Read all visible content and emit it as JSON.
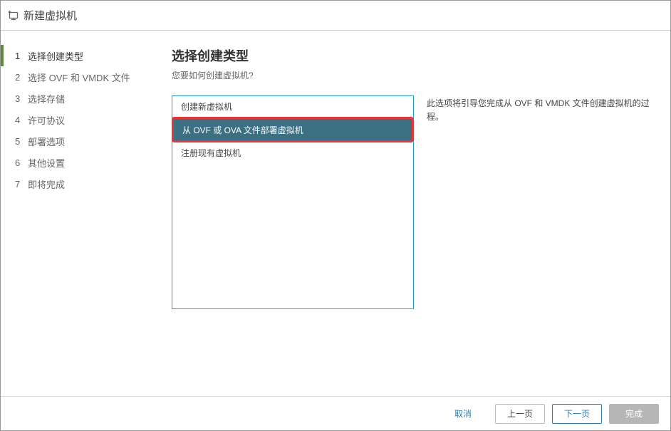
{
  "dialog": {
    "title": "新建虚拟机"
  },
  "sidebar": {
    "steps": [
      {
        "num": "1",
        "label": "选择创建类型",
        "current": true
      },
      {
        "num": "2",
        "label": "选择 OVF 和 VMDK 文件",
        "current": false
      },
      {
        "num": "3",
        "label": "选择存储",
        "current": false
      },
      {
        "num": "4",
        "label": "许可协议",
        "current": false
      },
      {
        "num": "5",
        "label": "部署选项",
        "current": false
      },
      {
        "num": "6",
        "label": "其他设置",
        "current": false
      },
      {
        "num": "7",
        "label": "即将完成",
        "current": false
      }
    ]
  },
  "main": {
    "title": "选择创建类型",
    "subtitle": "您要如何创建虚拟机?",
    "options": [
      {
        "label": "创建新虚拟机",
        "selected": false
      },
      {
        "label": "从 OVF 或 OVA 文件部署虚拟机",
        "selected": true
      },
      {
        "label": "注册现有虚拟机",
        "selected": false
      }
    ],
    "description": "此选项将引导您完成从 OVF 和 VMDK 文件创建虚拟机的过程。"
  },
  "footer": {
    "cancel": "取消",
    "prev": "上一页",
    "next": "下一页",
    "finish": "完成"
  }
}
